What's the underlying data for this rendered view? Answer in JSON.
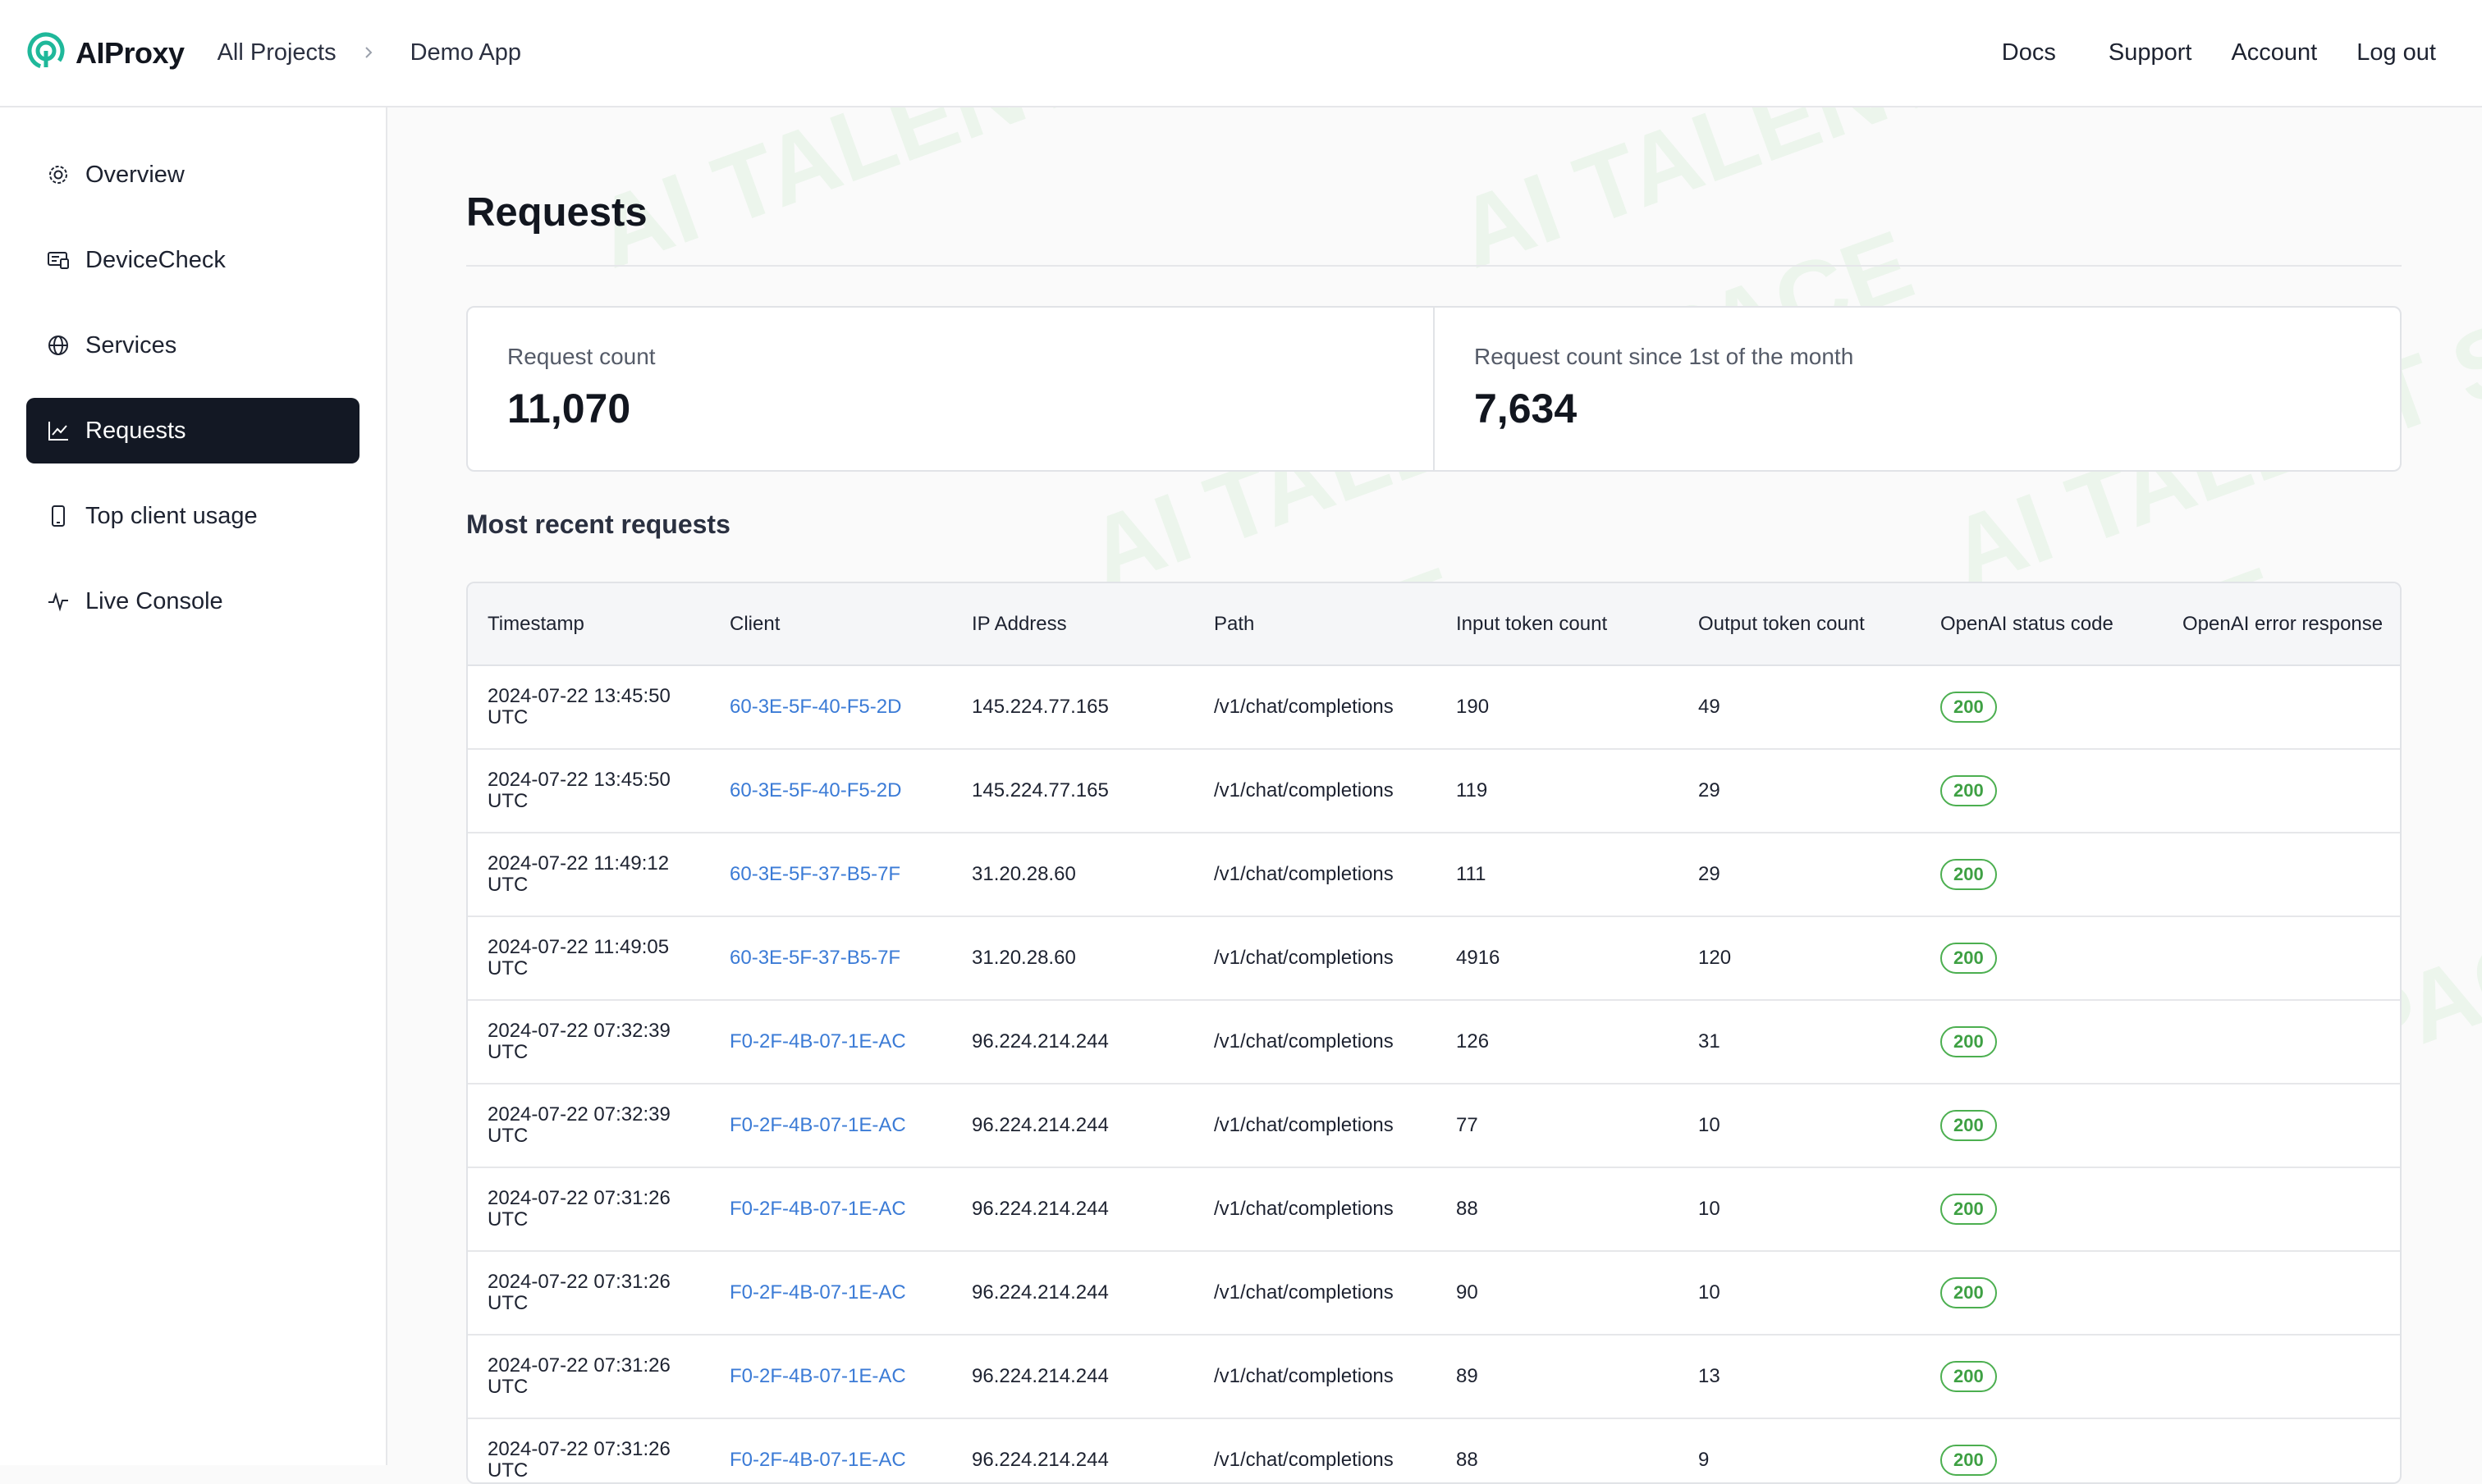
{
  "header": {
    "brand": "AIProxy",
    "breadcrumbs": [
      "All Projects",
      "Demo App"
    ],
    "nav": [
      "Docs",
      "Support",
      "Account",
      "Log out"
    ]
  },
  "sidebar": {
    "items": [
      {
        "label": "Overview",
        "icon": "gear-icon"
      },
      {
        "label": "DeviceCheck",
        "icon": "device-check-icon"
      },
      {
        "label": "Services",
        "icon": "globe-icon"
      },
      {
        "label": "Requests",
        "icon": "line-chart-icon",
        "active": true
      },
      {
        "label": "Top client usage",
        "icon": "phone-icon"
      },
      {
        "label": "Live Console",
        "icon": "activity-icon"
      }
    ]
  },
  "main": {
    "title": "Requests",
    "stats": [
      {
        "label": "Request count",
        "value": "11,070"
      },
      {
        "label": "Request count since 1st of the month",
        "value": "7,634"
      }
    ],
    "section_title": "Most recent requests",
    "table": {
      "columns": [
        "Timestamp",
        "Client",
        "IP Address",
        "Path",
        "Input token count",
        "Output token count",
        "OpenAI status code",
        "OpenAI error response"
      ],
      "rows": [
        {
          "timestamp": "2024-07-22 13:45:50 UTC",
          "client": "60-3E-5F-40-F5-2D",
          "ip": "145.224.77.165",
          "path": "/v1/chat/completions",
          "input": "190",
          "output": "49",
          "status": "200",
          "error": ""
        },
        {
          "timestamp": "2024-07-22 13:45:50 UTC",
          "client": "60-3E-5F-40-F5-2D",
          "ip": "145.224.77.165",
          "path": "/v1/chat/completions",
          "input": "119",
          "output": "29",
          "status": "200",
          "error": ""
        },
        {
          "timestamp": "2024-07-22 11:49:12 UTC",
          "client": "60-3E-5F-37-B5-7F",
          "ip": "31.20.28.60",
          "path": "/v1/chat/completions",
          "input": "111",
          "output": "29",
          "status": "200",
          "error": ""
        },
        {
          "timestamp": "2024-07-22 11:49:05 UTC",
          "client": "60-3E-5F-37-B5-7F",
          "ip": "31.20.28.60",
          "path": "/v1/chat/completions",
          "input": "4916",
          "output": "120",
          "status": "200",
          "error": ""
        },
        {
          "timestamp": "2024-07-22 07:32:39 UTC",
          "client": "F0-2F-4B-07-1E-AC",
          "ip": "96.224.214.244",
          "path": "/v1/chat/completions",
          "input": "126",
          "output": "31",
          "status": "200",
          "error": ""
        },
        {
          "timestamp": "2024-07-22 07:32:39 UTC",
          "client": "F0-2F-4B-07-1E-AC",
          "ip": "96.224.214.244",
          "path": "/v1/chat/completions",
          "input": "77",
          "output": "10",
          "status": "200",
          "error": ""
        },
        {
          "timestamp": "2024-07-22 07:31:26 UTC",
          "client": "F0-2F-4B-07-1E-AC",
          "ip": "96.224.214.244",
          "path": "/v1/chat/completions",
          "input": "88",
          "output": "10",
          "status": "200",
          "error": ""
        },
        {
          "timestamp": "2024-07-22 07:31:26 UTC",
          "client": "F0-2F-4B-07-1E-AC",
          "ip": "96.224.214.244",
          "path": "/v1/chat/completions",
          "input": "90",
          "output": "10",
          "status": "200",
          "error": ""
        },
        {
          "timestamp": "2024-07-22 07:31:26 UTC",
          "client": "F0-2F-4B-07-1E-AC",
          "ip": "96.224.214.244",
          "path": "/v1/chat/completions",
          "input": "89",
          "output": "13",
          "status": "200",
          "error": ""
        },
        {
          "timestamp": "2024-07-22 07:31:26 UTC",
          "client": "F0-2F-4B-07-1E-AC",
          "ip": "96.224.214.244",
          "path": "/v1/chat/completions",
          "input": "88",
          "output": "9",
          "status": "200",
          "error": ""
        }
      ]
    }
  },
  "watermark": "AI TALENT SPACE",
  "colors": {
    "brand": "#1fb89a",
    "active_nav": "#131824",
    "link": "#3b7bd6",
    "status_ok": "#4caf50"
  }
}
